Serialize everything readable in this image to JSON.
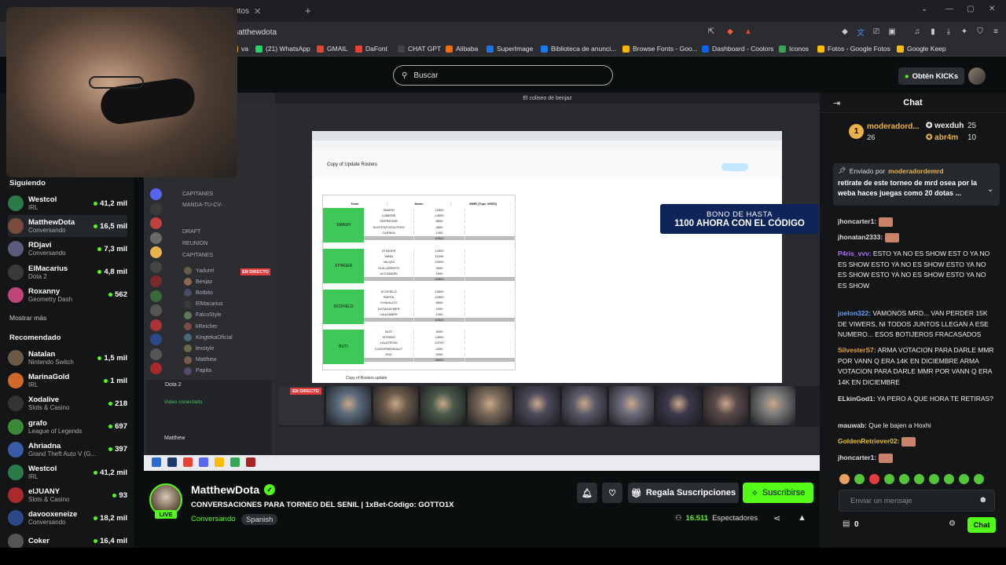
{
  "browser": {
    "tab_title": "Fotos",
    "url": "/matthewdota",
    "bookmarks": [
      {
        "label": "va",
        "color": "#e5a33b"
      },
      {
        "label": "(21) WhatsApp",
        "color": "#25d366"
      },
      {
        "label": "GMAIL",
        "color": "#e94235"
      },
      {
        "label": "DaFont",
        "color": "#e94235"
      },
      {
        "label": "CHAT GPT",
        "color": "#444"
      },
      {
        "label": "Alibaba",
        "color": "#ff6a00"
      },
      {
        "label": "SuperImage",
        "color": "#1a73e8"
      },
      {
        "label": "Biblioteca de anunci...",
        "color": "#1877f2"
      },
      {
        "label": "Browse Fonts - Goo...",
        "color": "#f4b400"
      },
      {
        "label": "Dashboard - Coolors",
        "color": "#0066ff"
      },
      {
        "label": "Iconos",
        "color": "#34a853"
      },
      {
        "label": "Fotos - Google Fotos",
        "color": "#fbbc05"
      },
      {
        "label": "Google Keep",
        "color": "#fbbc05"
      }
    ]
  },
  "header": {
    "search_placeholder": "Buscar",
    "kicks_button": "Obtén KICKs"
  },
  "sidebar": {
    "following_title": "Siguiendo",
    "following": [
      {
        "name": "Westcol",
        "category": "IRL",
        "viewers": "41,2 mil",
        "color": "#2a7a4a"
      },
      {
        "name": "MatthewDota",
        "category": "Conversando",
        "viewers": "16,5 mil",
        "color": "#7a4a3a",
        "active": true
      },
      {
        "name": "RDjavi",
        "category": "Conversando",
        "viewers": "7,3 mil",
        "color": "#5a5a7a"
      },
      {
        "name": "ElMacarius",
        "category": "Dota 2",
        "viewers": "4,8 mil",
        "color": "#3a3a3a"
      },
      {
        "name": "Roxanny",
        "category": "Geometry Dash",
        "viewers": "562",
        "color": "#c0447a"
      }
    ],
    "show_more": "Mostrar más",
    "recommended_title": "Recomendado",
    "recommended": [
      {
        "name": "Natalan",
        "category": "Nintendo Switch",
        "viewers": "1,5 mil",
        "color": "#6a5a4a"
      },
      {
        "name": "MarinaGold",
        "category": "IRL",
        "viewers": "1 mil",
        "color": "#d06a2a"
      },
      {
        "name": "Xodalive",
        "category": "Slots & Casino",
        "viewers": "218",
        "color": "#333"
      },
      {
        "name": "grafo",
        "category": "League of Legends",
        "viewers": "697",
        "color": "#3a8a3a"
      },
      {
        "name": "Ahriadna",
        "category": "Grand Theft Auto V (G...",
        "viewers": "397",
        "color": "#3a5aaa"
      },
      {
        "name": "Westcol",
        "category": "IRL",
        "viewers": "41,2 mil",
        "color": "#2a7a4a"
      },
      {
        "name": "elJUANY",
        "category": "Slots & Casino",
        "viewers": "93",
        "color": "#aa2a2a"
      },
      {
        "name": "davooxeneize",
        "category": "Conversando",
        "viewers": "18,2 mil",
        "color": "#2a4a8a"
      },
      {
        "name": "Coker",
        "category": "",
        "viewers": "16,4 mil",
        "color": "#555"
      }
    ]
  },
  "stream": {
    "window_title": "El coliseo de benjaz",
    "promo_line1": "BONO DE HASTA",
    "promo_line2": "1100 AHORA CON EL CÓDIGO",
    "sheet_title": "Copy of Update Rosters",
    "sheet_headers": [
      "Team",
      "Name",
      "MMR (Tope 40500)"
    ],
    "teams": [
      {
        "name": "SMASH",
        "rows": [
          [
            "SMASH",
            "12500"
          ],
          [
            "LUMIERE",
            "14000"
          ],
          [
            "DEPRESOR",
            "8500"
          ],
          [
            "SUSTENTOSOLTERO",
            "3500"
          ],
          [
            "OLENKA",
            "1000"
          ]
        ],
        "total": "40500"
      },
      {
        "name": "STINGER",
        "rows": [
          [
            "STINGER",
            "12500"
          ],
          [
            "VANN",
            "11000"
          ],
          [
            "VALQUI",
            "10000"
          ],
          [
            "GUILLERMITO",
            "3500"
          ],
          [
            "ACCAMAIRI",
            "1000"
          ]
        ],
        "total": "40500"
      },
      {
        "name": "SCOFIELD",
        "rows": [
          [
            "SCOFIELD",
            "15500"
          ],
          [
            "PAPITA",
            "10500"
          ],
          [
            "CHAVALITO",
            "8500"
          ],
          [
            "DOTAGAYMER",
            "4000"
          ],
          [
            "LAUGAMER",
            "1000"
          ]
        ],
        "total": "40500"
      },
      {
        "name": "BUTI",
        "rows": [
          [
            "BUTI",
            "3000"
          ],
          [
            "XOTARO",
            "14000"
          ],
          [
            "LALATRONI",
            "14700"
          ],
          [
            "LUISORMENDIA27",
            "4200"
          ],
          [
            "SOE",
            "3000"
          ]
        ],
        "total": "38900"
      }
    ],
    "discord_channels": [
      "CAPITANES",
      "MANDA-TU-CV-",
      "DRAFT",
      "REUNION",
      "CAPITANES"
    ],
    "discord_users": [
      "Yadurel",
      "Benjaz",
      "Botbito",
      "ElMacarius",
      "FalcoStyle",
      "kReicher",
      "KingtekaOficial",
      "lexstyle",
      "Matthew",
      "Papita"
    ],
    "discord_voice": "Dota 2",
    "discord_voice_status": "Video conectado",
    "discord_user": "Matthew",
    "en_directo": "EN DIRECTO",
    "sheet_tab": "Copy of Rosters update"
  },
  "info": {
    "streamer": "MatthewDota",
    "live": "LIVE",
    "title": "CONVERSACIONES PARA TORNEO DEL SENIL | 1xBet-Código: GOTTO1X",
    "category": "Conversando",
    "language": "Spanish",
    "gift_subs": "Regala Suscripciones",
    "subscribe": "Suscribirse",
    "viewers_count": "16.511",
    "viewers_label": "Espectadores"
  },
  "chat": {
    "title": "Chat",
    "top": [
      {
        "name": "moderadord...",
        "count": "26"
      },
      {
        "name": "wexduh",
        "count": "25"
      },
      {
        "name": "abr4m",
        "count": "10"
      }
    ],
    "pinned_label": "Enviado por",
    "pinned_user": "moderadordemrd",
    "pinned_text": "retirate de este torneo de mrd osea por la weba haces juegas como 20 dotas ...",
    "messages": [
      {
        "user": "jhoncarter1:",
        "color": "#ddd",
        "text": ""
      },
      {
        "user": "jhonatan2333:",
        "color": "#ddd",
        "text": ""
      },
      {
        "user": "P4ris_vvv:",
        "color": "#b070ff",
        "text": "ESTO YA NO ES SHOW EST O YA NO ES SHOW ESTO YA NO ES SHOW ESTO YA NO ES SHOW ESTO YA NO ES SHOW ESTO YA NO ES SHOW"
      },
      {
        "user": "joelon322:",
        "color": "#6aa0ff",
        "text": "VAMONOS MRD... VAN PERDER 15K DE VIWERS, NI TODOS JUNTOS LLEGAN A ESE NUMERO... ESOS BOTIJEROS FRACASADOS"
      },
      {
        "user": "SilvesterS7:",
        "color": "#e8a040",
        "text": "ARMA VOTACION PARA DARLE MMR POR VANN Q ERA 14K EN DICIEMBRE ARMA VOTACION PARA DARLE MMR POR VANN Q ERA 14K EN DICIEMBRE"
      },
      {
        "user": "ELkinGod1:",
        "color": "#ddd",
        "text": "YA PERO A QUE HORA TE RETIRAS?"
      },
      {
        "user": "mauwab:",
        "color": "#ddd",
        "text": "Que le bajen a Hoxhi"
      },
      {
        "user": "GoldenRetriever02:",
        "color": "#e8c020",
        "text": ""
      },
      {
        "user": "jhoncarter1:",
        "color": "#ddd",
        "text": ""
      }
    ],
    "input_placeholder": "Enviar un mensaje",
    "kicks_count": "0",
    "send": "Chat"
  }
}
